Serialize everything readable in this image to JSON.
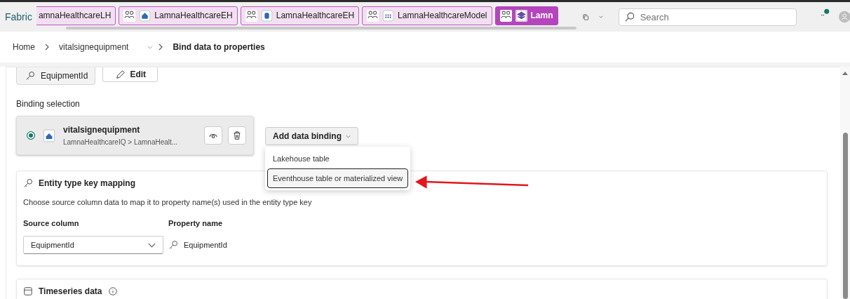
{
  "app_name": "Fabric",
  "tabs": [
    {
      "label": "amnaHealthcareLH",
      "kind": "plain",
      "selected": false
    },
    {
      "label": "LamnaHealthcareEH",
      "kind": "eventhouse",
      "selected": false
    },
    {
      "label": "LamnaHealthcareEH",
      "kind": "database",
      "selected": false
    },
    {
      "label": "LamnaHealthcareModel",
      "kind": "model",
      "selected": false
    },
    {
      "label": "Lamn",
      "kind": "ontology",
      "selected": true
    }
  ],
  "search": {
    "placeholder": "Search"
  },
  "breadcrumb": [
    {
      "label": "Home",
      "has_menu": false
    },
    {
      "label": "vitalsignequipment",
      "has_menu": true
    },
    {
      "label": "Bind data to properties",
      "has_menu": false
    }
  ],
  "key_chip": "EquipmentId",
  "edit_button": "Edit",
  "binding_selection": {
    "title": "Binding selection",
    "bindings": [
      {
        "name": "vitalsignequipment",
        "path": "LamnaHealthcareIQ > LamnaHealt...",
        "selected": true
      }
    ],
    "add_button": "Add data binding",
    "menu": [
      {
        "label": "Lakehouse table",
        "selected": false
      },
      {
        "label": "Eventhouse table or materialized view",
        "selected": true
      }
    ]
  },
  "key_mapping": {
    "title": "Entity type key mapping",
    "description": "Choose source column data to map it to property name(s) used in the entity type key",
    "source_label": "Source column",
    "property_label": "Property name",
    "source_value": "EquipmentId",
    "property_value": "EquipmentId"
  },
  "timeseries": {
    "title": "Timeseries data"
  }
}
